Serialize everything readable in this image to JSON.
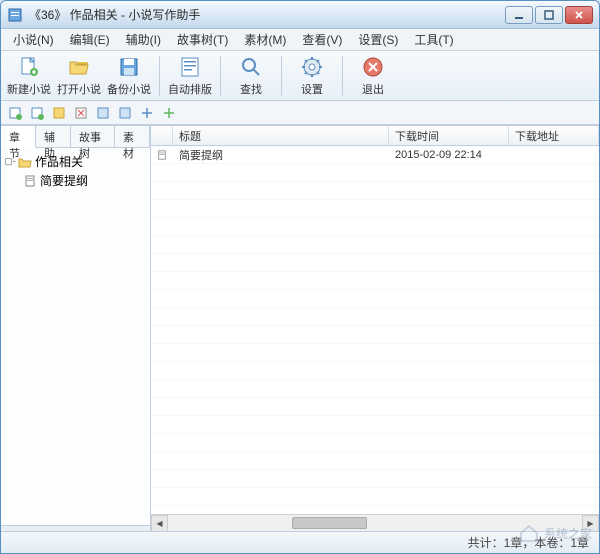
{
  "window": {
    "title": "《36》 作品相关 - 小说写作助手"
  },
  "menu": {
    "items": [
      "小说(N)",
      "编辑(E)",
      "辅助(I)",
      "故事树(T)",
      "素材(M)",
      "查看(V)",
      "设置(S)",
      "工具(T)"
    ]
  },
  "toolbar": {
    "items": [
      {
        "id": "new-novel",
        "label": "新建小说"
      },
      {
        "id": "open-novel",
        "label": "打开小说"
      },
      {
        "id": "backup-novel",
        "label": "备份小说"
      },
      {
        "sep": true
      },
      {
        "id": "auto-typeset",
        "label": "自动排版"
      },
      {
        "sep": true
      },
      {
        "id": "find",
        "label": "查找"
      },
      {
        "sep": true
      },
      {
        "id": "settings",
        "label": "设置"
      },
      {
        "sep": true
      },
      {
        "id": "exit",
        "label": "退出"
      }
    ]
  },
  "sidebar": {
    "tabs": [
      "章节",
      "辅助",
      "故事树",
      "素材"
    ],
    "activeTab": 0,
    "tree": {
      "root": {
        "label": "作品相关",
        "expanded": true
      },
      "children": [
        {
          "label": "简要提纲"
        }
      ]
    }
  },
  "list": {
    "columns": {
      "title": "标题",
      "time": "下载时间",
      "url": "下载地址"
    },
    "rows": [
      {
        "title": "简要提纲",
        "time": "2015-02-09 22:14",
        "url": ""
      }
    ]
  },
  "status": {
    "text": "共计：1章，本卷：1章"
  },
  "watermark": "系统之家"
}
